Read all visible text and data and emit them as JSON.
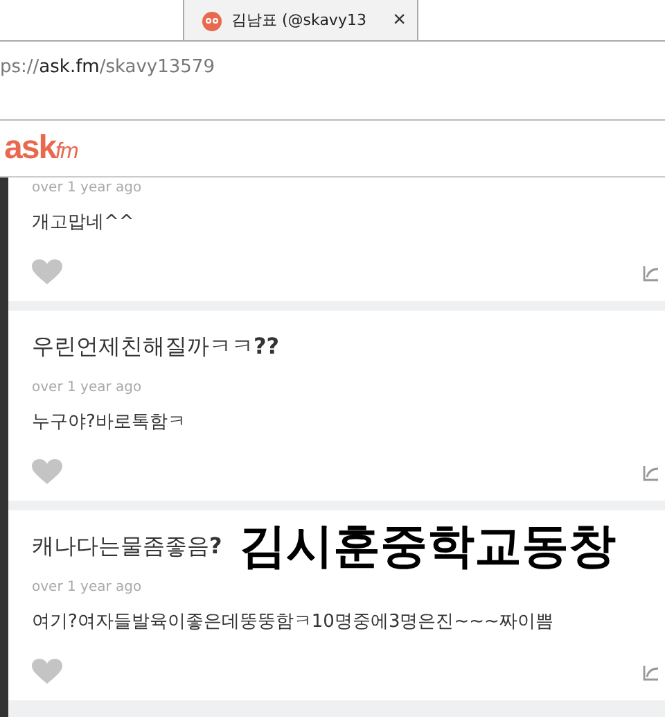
{
  "browser_tab": {
    "title": "김남표 (@skavy13",
    "close": "×",
    "selected": true
  },
  "address_bar": {
    "scheme": "ps://",
    "host": "ask.fm",
    "path": "/skavy13579"
  },
  "site_header": {
    "logo_main": "ask",
    "logo_sub": "fm"
  },
  "posts": [
    {
      "time": "over 1 year ago",
      "answer": "개고맙네^^"
    },
    {
      "question": "우린언제친해질까ㅋㅋ**??**",
      "time": "over 1 year ago",
      "answer": "누구야?바로톡함ㅋ"
    },
    {
      "question": "캐나다는물좀좋음**?**",
      "caption": "김시훈중학교동창",
      "time": "over 1 year ago",
      "answer": "여기?여자들발육이좋은데뚱뚱함ㅋ10명중에3명은진~~~짜이쁨"
    }
  ]
}
